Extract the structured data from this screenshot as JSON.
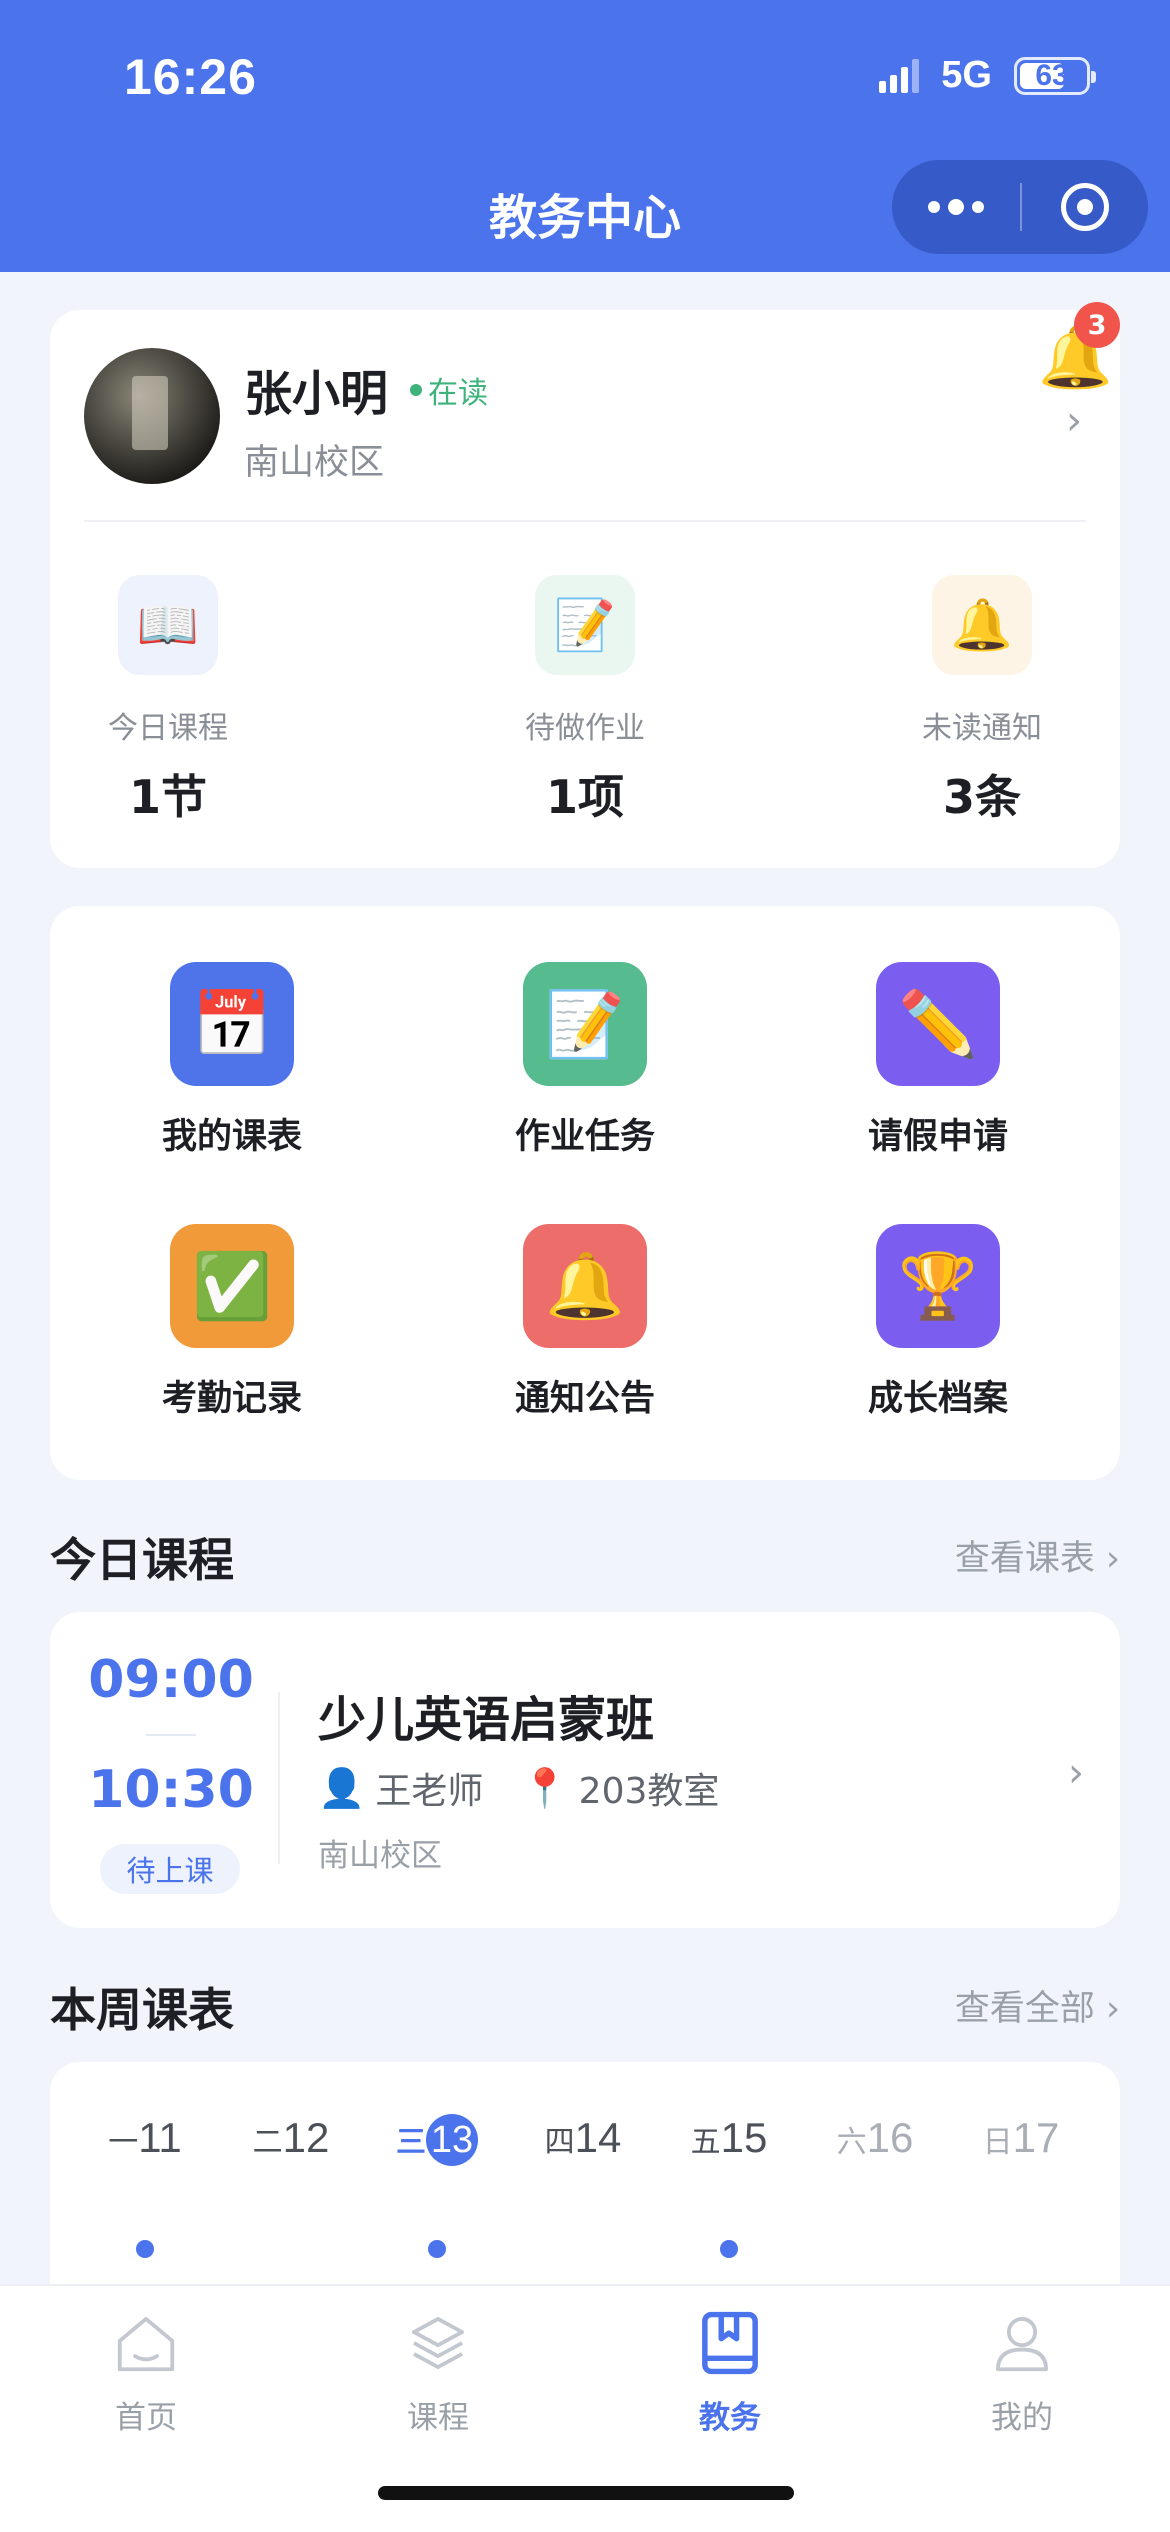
{
  "status_bar": {
    "time": "16:26",
    "network": "5G",
    "battery": "63",
    "battery_level": 0.63
  },
  "nav": {
    "title": "教务中心",
    "more_icon": "more-dots-icon",
    "close_icon": "target-close-icon"
  },
  "profile": {
    "name": "张小明",
    "state": "在读",
    "campus": "南山校区",
    "notification_badge": "3",
    "stats": [
      {
        "icon": "book-icon",
        "label": "今日课程",
        "value": "1节"
      },
      {
        "icon": "memo-icon",
        "label": "待做作业",
        "value": "1项"
      },
      {
        "icon": "bell-icon",
        "label": "未读通知",
        "value": "3条"
      }
    ]
  },
  "menu": {
    "items": [
      {
        "icon": "calendar-icon",
        "label": "我的课表"
      },
      {
        "icon": "memo-icon",
        "label": "作业任务"
      },
      {
        "icon": "pencil-icon",
        "label": "请假申请"
      },
      {
        "icon": "check-icon",
        "label": "考勤记录"
      },
      {
        "icon": "bell-icon",
        "label": "通知公告"
      },
      {
        "icon": "trophy-icon",
        "label": "成长档案"
      }
    ]
  },
  "today": {
    "title": "今日课程",
    "link": "查看课表 ›",
    "course": {
      "start": "09:00",
      "end": "10:30",
      "status": "待上课",
      "name": "少儿英语启蒙班",
      "teacher": "王老师",
      "room": "203教室",
      "campus": "南山校区"
    }
  },
  "week": {
    "title": "本周课表",
    "link": "查看全部 ›",
    "days": [
      {
        "weekday": "一",
        "date": "11",
        "has_class": true
      },
      {
        "weekday": "二",
        "date": "12",
        "has_class": false
      },
      {
        "weekday": "三",
        "date": "13",
        "has_class": true,
        "today": true
      },
      {
        "weekday": "四",
        "date": "14",
        "has_class": false
      },
      {
        "weekday": "五",
        "date": "15",
        "has_class": true
      },
      {
        "weekday": "六",
        "date": "16",
        "has_class": false
      },
      {
        "weekday": "日",
        "date": "17",
        "has_class": false
      }
    ]
  },
  "tabbar": {
    "active": "教务",
    "items": [
      {
        "icon": "home-icon",
        "label": "首页"
      },
      {
        "icon": "layers-icon",
        "label": "课程"
      },
      {
        "icon": "book-bookmark-icon",
        "label": "教务"
      },
      {
        "icon": "user-icon",
        "label": "我的"
      }
    ]
  },
  "colors": {
    "primary": "#4a73ec",
    "online": "#3eb37b",
    "badge": "#f0544b"
  }
}
